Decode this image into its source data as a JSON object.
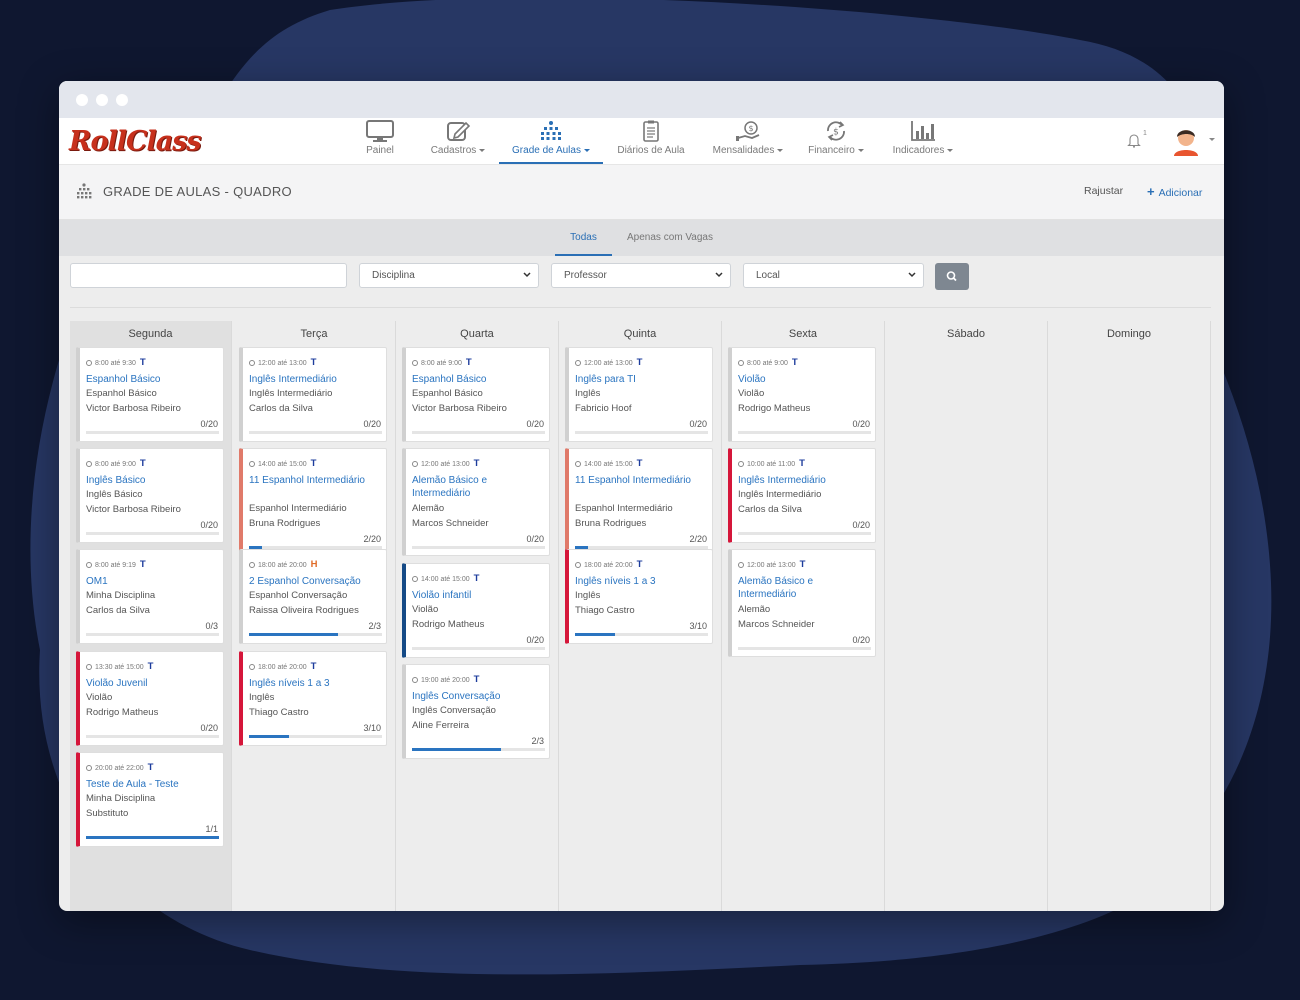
{
  "app": {
    "logo": "RollClass",
    "nav": [
      {
        "label": "Painel",
        "icon": "monitor-icon",
        "dropdown": false,
        "active": false
      },
      {
        "label": "Cadastros",
        "icon": "edit-icon",
        "dropdown": true,
        "active": false
      },
      {
        "label": "Grade de Aulas",
        "icon": "class-grid-icon",
        "dropdown": true,
        "active": true
      },
      {
        "label": "Diários de Aula",
        "icon": "clipboard-icon",
        "dropdown": false,
        "active": false
      },
      {
        "label": "Mensalidades",
        "icon": "money-hand-icon",
        "dropdown": true,
        "active": false
      },
      {
        "label": "Financeiro",
        "icon": "dollar-arrows-icon",
        "dropdown": true,
        "active": false
      },
      {
        "label": "Indicadores",
        "icon": "bar-chart-icon",
        "dropdown": true,
        "active": false
      }
    ],
    "notifications_count": "1"
  },
  "page": {
    "title": "GRADE DE AULAS - QUADRO",
    "reajustar": "Rajustar",
    "adicionar": "Adicionar"
  },
  "tabs": {
    "all": "Todas",
    "vacancies": "Apenas com Vagas",
    "active": "all"
  },
  "filters": {
    "search_placeholder": "",
    "disciplina": "Disciplina",
    "professor": "Professor",
    "local": "Local"
  },
  "days": [
    {
      "name": "Segunda",
      "cards": [
        {
          "time": "8:00 até 9:30",
          "tag": "T",
          "title": "Espanhol Básico",
          "subject": "Espanhol Básico",
          "teacher": "Victor Barbosa Ribeiro",
          "count": "0/20",
          "fill": 0,
          "color": "gray"
        },
        {
          "time": "8:00 até 9:00",
          "tag": "T",
          "title": "Inglês Básico",
          "subject": "Inglês Básico",
          "teacher": "Victor Barbosa Ribeiro",
          "count": "0/20",
          "fill": 0,
          "color": "gray"
        },
        {
          "time": "8:00 até 9:19",
          "tag": "T",
          "title": "OM1",
          "subject": "Minha Disciplina",
          "teacher": "Carlos da Silva",
          "count": "0/3",
          "fill": 0,
          "color": "gray"
        },
        {
          "time": "13:30 até 15:00",
          "tag": "T",
          "title": "Violão Juvenil",
          "subject": "Violão",
          "teacher": "Rodrigo Matheus",
          "count": "0/20",
          "fill": 0,
          "color": "red"
        },
        {
          "time": "20:00 até 22:00",
          "tag": "T",
          "title": "Teste de Aula - Teste",
          "subject": "Minha Disciplina",
          "teacher": "Substituto",
          "count": "1/1",
          "fill": 1,
          "color": "red"
        }
      ]
    },
    {
      "name": "Terça",
      "cards": [
        {
          "time": "12:00 até 13:00",
          "tag": "T",
          "title": "Inglês Intermediário",
          "subject": "Inglês Intermediário",
          "teacher": "Carlos da Silva",
          "count": "0/20",
          "fill": 0,
          "color": "gray"
        },
        {
          "time": "14:00 até 15:00",
          "tag": "T",
          "title": "11 Espanhol Intermediário",
          "subject": "Espanhol Intermediário",
          "teacher": "Bruna Rodrigues",
          "count": "2/20",
          "fill": 0.1,
          "color": "salmon"
        },
        {
          "time": "18:00 até 20:00",
          "tag": "H",
          "title": "2 Espanhol Conversação",
          "subject": "Espanhol Conversação",
          "teacher": "Raissa Oliveira Rodrigues",
          "count": "2/3",
          "fill": 0.667,
          "color": "gray"
        },
        {
          "time": "18:00 até 20:00",
          "tag": "T",
          "title": "Inglês níveis 1 a 3",
          "subject": "Inglês",
          "teacher": "Thiago Castro",
          "count": "3/10",
          "fill": 0.3,
          "color": "red"
        }
      ]
    },
    {
      "name": "Quarta",
      "cards": [
        {
          "time": "8:00 até 9:00",
          "tag": "T",
          "title": "Espanhol Básico",
          "subject": "Espanhol Básico",
          "teacher": "Victor Barbosa Ribeiro",
          "count": "0/20",
          "fill": 0,
          "color": "gray"
        },
        {
          "time": "12:00 até 13:00",
          "tag": "T",
          "title": "Alemão Básico e Intermediário",
          "subject": "Alemão",
          "teacher": "Marcos Schneider",
          "count": "0/20",
          "fill": 0,
          "color": "gray"
        },
        {
          "time": "14:00 até 15:00",
          "tag": "T",
          "title": "Violão infantil",
          "subject": "Violão",
          "teacher": "Rodrigo Matheus",
          "count": "0/20",
          "fill": 0,
          "color": "navy"
        },
        {
          "time": "19:00 até 20:00",
          "tag": "T",
          "title": "Inglês Conversação",
          "subject": "Inglês Conversação",
          "teacher": "Aline Ferreira",
          "count": "2/3",
          "fill": 0.667,
          "color": "gray"
        }
      ]
    },
    {
      "name": "Quinta",
      "cards": [
        {
          "time": "12:00 até 13:00",
          "tag": "T",
          "title": "Inglês para TI",
          "subject": "Inglês",
          "teacher": "Fabricio Hoof",
          "count": "0/20",
          "fill": 0,
          "color": "gray"
        },
        {
          "time": "14:00 até 15:00",
          "tag": "T",
          "title": "11 Espanhol Intermediário",
          "subject": "Espanhol Intermediário",
          "teacher": "Bruna Rodrigues",
          "count": "2/20",
          "fill": 0.1,
          "color": "salmon"
        },
        {
          "time": "18:00 até 20:00",
          "tag": "T",
          "title": "Inglês níveis 1 a 3",
          "subject": "Inglês",
          "teacher": "Thiago Castro",
          "count": "3/10",
          "fill": 0.3,
          "color": "red"
        }
      ]
    },
    {
      "name": "Sexta",
      "cards": [
        {
          "time": "8:00 até 9:00",
          "tag": "T",
          "title": "Violão",
          "subject": "Violão",
          "teacher": "Rodrigo Matheus",
          "count": "0/20",
          "fill": 0,
          "color": "gray"
        },
        {
          "time": "10:00 até 11:00",
          "tag": "T",
          "title": "Inglês Intermediário",
          "subject": "Inglês Intermediário",
          "teacher": "Carlos da Silva",
          "count": "0/20",
          "fill": 0,
          "color": "red"
        },
        {
          "time": "12:00 até 13:00",
          "tag": "T",
          "title": "Alemão Básico e Intermediário",
          "subject": "Alemão",
          "teacher": "Marcos Schneider",
          "count": "0/20",
          "fill": 0,
          "color": "gray"
        }
      ]
    },
    {
      "name": "Sábado",
      "cards": []
    },
    {
      "name": "Domingo",
      "cards": []
    }
  ]
}
